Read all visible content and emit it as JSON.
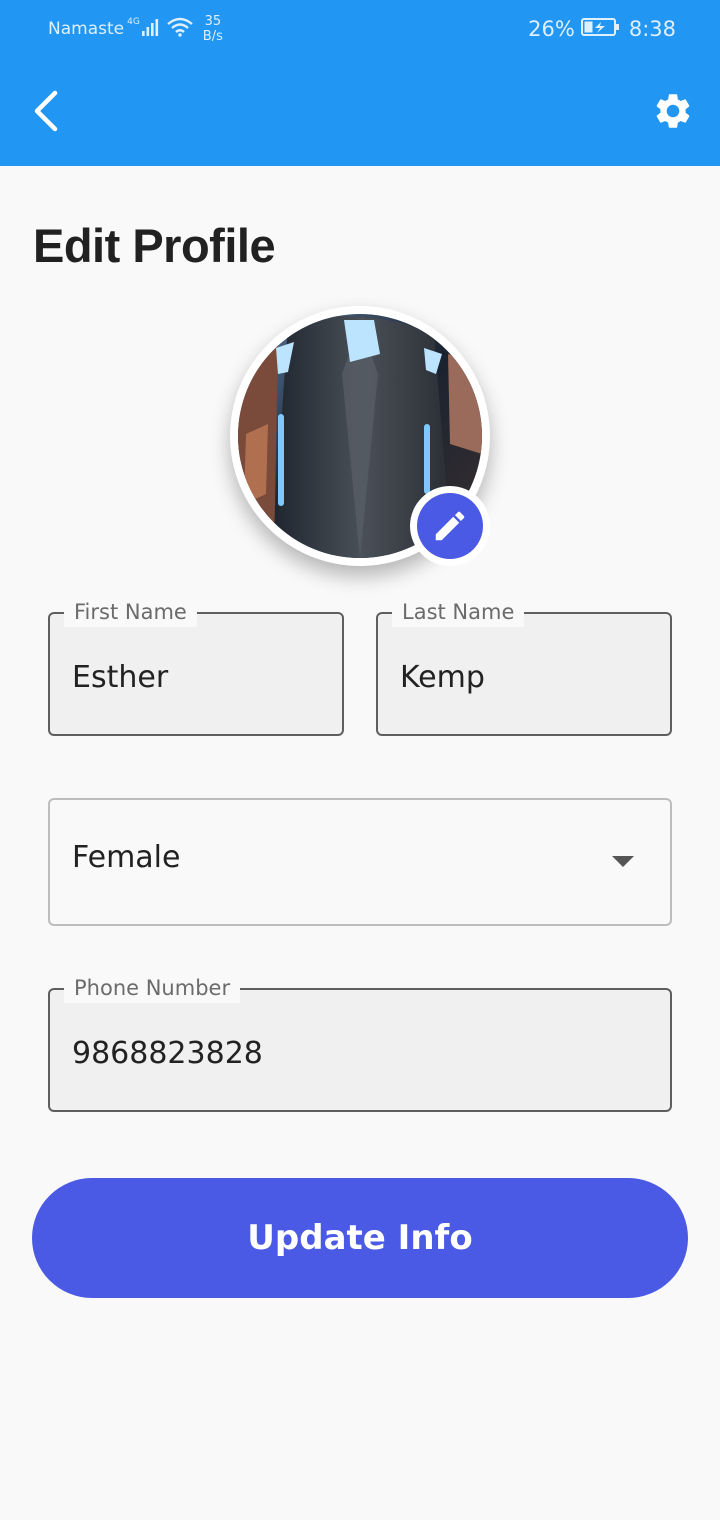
{
  "status_bar": {
    "carrier": "Namaste",
    "network_type": "4G",
    "net_speed_value": "35",
    "net_speed_unit": "B/s",
    "battery": "26%",
    "time": "8:38"
  },
  "toolbar": {
    "back_icon": "chevron-left",
    "settings_icon": "gear"
  },
  "page": {
    "title": "Edit Profile"
  },
  "avatar": {
    "edit_icon": "pencil"
  },
  "form": {
    "first_name": {
      "label": "First Name",
      "value": "Esther"
    },
    "last_name": {
      "label": "Last Name",
      "value": "Kemp"
    },
    "gender": {
      "value": "Female"
    },
    "phone": {
      "label": "Phone Number",
      "value": "9868823828"
    }
  },
  "actions": {
    "update_label": "Update Info"
  },
  "colors": {
    "app_bar": "#2196f3",
    "accent": "#4b5ae4",
    "background": "#f9f9f9"
  }
}
